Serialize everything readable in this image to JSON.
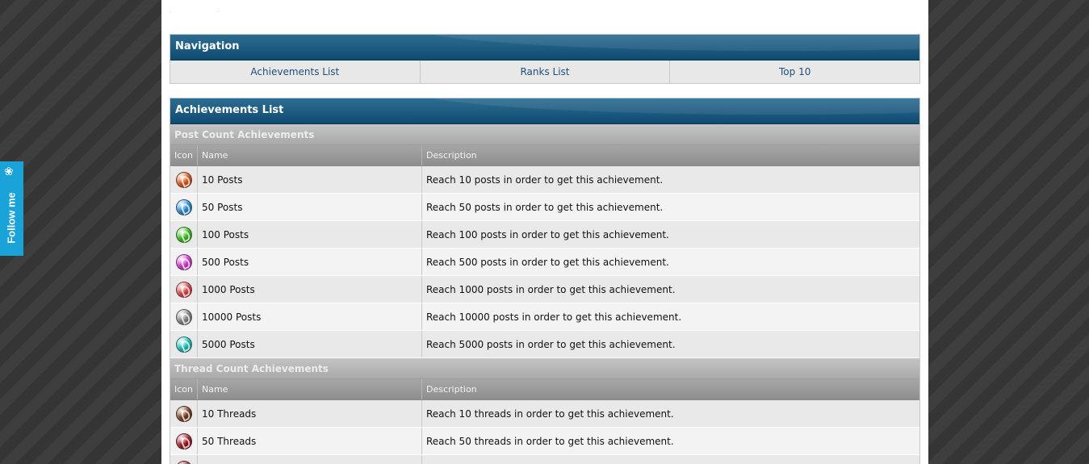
{
  "follow_widget": {
    "label": "Follow me",
    "icon": "twitter-bird-icon"
  },
  "navigation": {
    "title": "Navigation",
    "links": [
      "Achievements List",
      "Ranks List",
      "Top 10"
    ]
  },
  "achievements": {
    "title": "Achievements List",
    "columns": {
      "icon": "Icon",
      "name": "Name",
      "description": "Description"
    },
    "sections": [
      {
        "title": "Post Count Achievements",
        "items": [
          {
            "name": "10 Posts",
            "description": "Reach 10 posts in order to get this achievement.",
            "color": "#e2571a"
          },
          {
            "name": "50 Posts",
            "description": "Reach 50 posts in order to get this achievement.",
            "color": "#2b8fd9"
          },
          {
            "name": "100 Posts",
            "description": "Reach 100 posts in order to get this achievement.",
            "color": "#3cc21f"
          },
          {
            "name": "500 Posts",
            "description": "Reach 500 posts in order to get this achievement.",
            "color": "#d63ad6"
          },
          {
            "name": "1000 Posts",
            "description": "Reach 1000 posts in order to get this achievement.",
            "color": "#e0454a"
          },
          {
            "name": "10000 Posts",
            "description": "Reach 10000 posts in order to get this achievement.",
            "color": "#8a8a8a"
          },
          {
            "name": "5000 Posts",
            "description": "Reach 5000 posts in order to get this achievement.",
            "color": "#1fc3bd"
          }
        ]
      },
      {
        "title": "Thread Count Achievements",
        "items": [
          {
            "name": "10 Threads",
            "description": "Reach 10 threads in order to get this achievement.",
            "color": "#7a3c1c"
          },
          {
            "name": "50 Threads",
            "description": "Reach 50 threads in order to get this achievement.",
            "color": "#a0151d"
          },
          {
            "name": "",
            "description": "",
            "color": "#8a1a2a"
          }
        ]
      }
    ]
  }
}
